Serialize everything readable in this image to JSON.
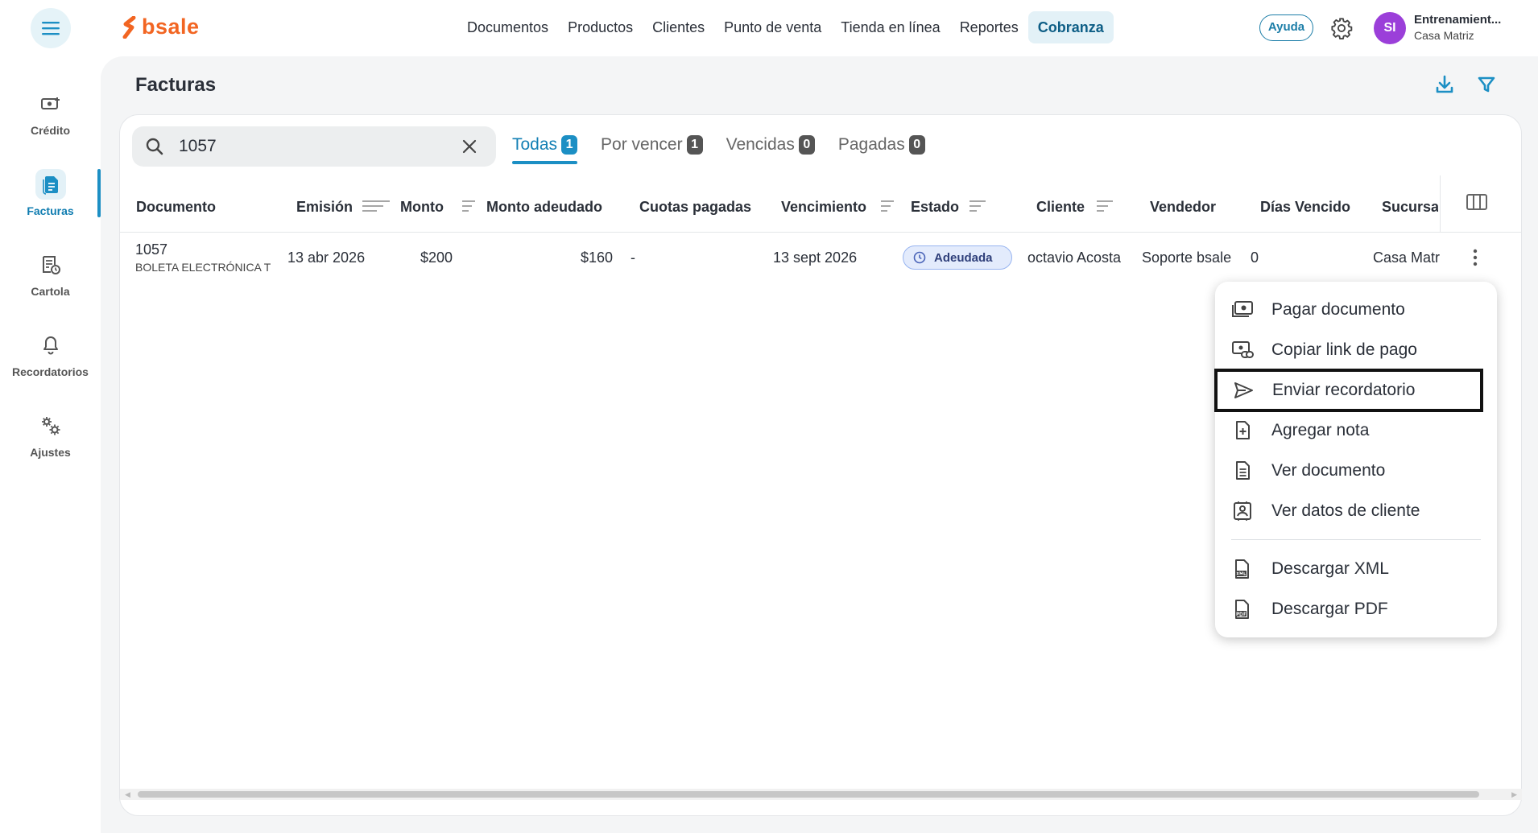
{
  "app": {
    "logo_text": "bsale",
    "brand_color": "#f26522",
    "accent": "#1c8fc4"
  },
  "nav": {
    "items": [
      "Documentos",
      "Productos",
      "Clientes",
      "Punto de venta",
      "Tienda en línea",
      "Reportes",
      "Cobranza"
    ],
    "active": "Cobranza"
  },
  "header": {
    "help_label": "Ayuda",
    "avatar_initials": "SI",
    "user_name": "Entrenamient...",
    "user_branch": "Casa Matriz"
  },
  "sidebar": {
    "items": [
      {
        "label": "Crédito",
        "icon": "money-icon"
      },
      {
        "label": "Facturas",
        "icon": "document-icon",
        "active": true
      },
      {
        "label": "Cartola",
        "icon": "statement-icon"
      },
      {
        "label": "Recordatorios",
        "icon": "bell-icon"
      },
      {
        "label": "Ajustes",
        "icon": "gears-icon"
      }
    ]
  },
  "page": {
    "title": "Facturas"
  },
  "search": {
    "value": "1057",
    "placeholder": ""
  },
  "tabs": [
    {
      "label": "Todas",
      "count": "1",
      "active": true
    },
    {
      "label": "Por vencer",
      "count": "1"
    },
    {
      "label": "Vencidas",
      "count": "0"
    },
    {
      "label": "Pagadas",
      "count": "0"
    }
  ],
  "table": {
    "columns": [
      "Documento",
      "Emisión",
      "Monto",
      "Monto adeudado",
      "Cuotas pagadas",
      "Vencimiento",
      "Estado",
      "Cliente",
      "Vendedor",
      "Días Vencido",
      "Sucursal"
    ],
    "rows": [
      {
        "documento": "1057",
        "tipo": "BOLETA ELECTRÓNICA T",
        "emision": "13 abr 2026",
        "monto": "$200",
        "monto_adeudado": "$160",
        "cuotas_pagadas": "-",
        "vencimiento": "13 sept 2026",
        "estado": "Adeudada",
        "cliente": "octavio Acosta",
        "vendedor": "Soporte bsale",
        "dias_vencido": "0",
        "sucursal": "Casa Matr"
      }
    ]
  },
  "menu": {
    "items": [
      {
        "label": "Pagar documento",
        "icon": "cash-icon"
      },
      {
        "label": "Copiar link de pago",
        "icon": "link-icon"
      },
      {
        "label": "Enviar recordatorio",
        "icon": "send-icon",
        "highlighted": true
      },
      {
        "label": "Agregar nota",
        "icon": "add-note-icon"
      },
      {
        "label": "Ver documento",
        "icon": "document-lines-icon"
      },
      {
        "label": "Ver datos de cliente",
        "icon": "contact-card-icon"
      },
      {
        "label": "Descargar XML",
        "icon": "xml-file-icon"
      },
      {
        "label": "Descargar PDF",
        "icon": "pdf-file-icon"
      }
    ]
  }
}
